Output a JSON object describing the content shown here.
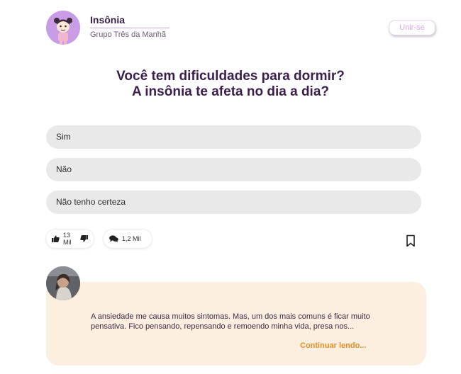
{
  "header": {
    "group_title": "Insônia",
    "group_subtitle": "Grupo Três da Manhã",
    "join_label": "Unir-se"
  },
  "question": {
    "line1": "Você tem dificuldades para dormir?",
    "line2": "A insônia te afeta no dia a dia?"
  },
  "options": [
    "Sim",
    "Não",
    "Não tenho certeza"
  ],
  "actions": {
    "likes_count": "13 Mil",
    "comments_count": "1,2 Mil"
  },
  "comment": {
    "text_line1": "A ansiedade me causa muitos sintomas. Mas, um dos mais comuns é ficar muito",
    "text_line2": "pensativa. Fico pensando, repensando e remoendo minha vida, presa nos...",
    "continue_label": "Continuar lendo..."
  },
  "colors": {
    "title": "#3b1f4a",
    "option_bg": "#e9e9e9",
    "card_bg": "#fcefe0",
    "accent_orange": "#e58e25",
    "avatar_bg": "#c99ce6"
  },
  "icons": [
    "thumbs-up-icon",
    "thumbs-down-icon",
    "chat-bubbles-icon",
    "bookmark-icon"
  ]
}
